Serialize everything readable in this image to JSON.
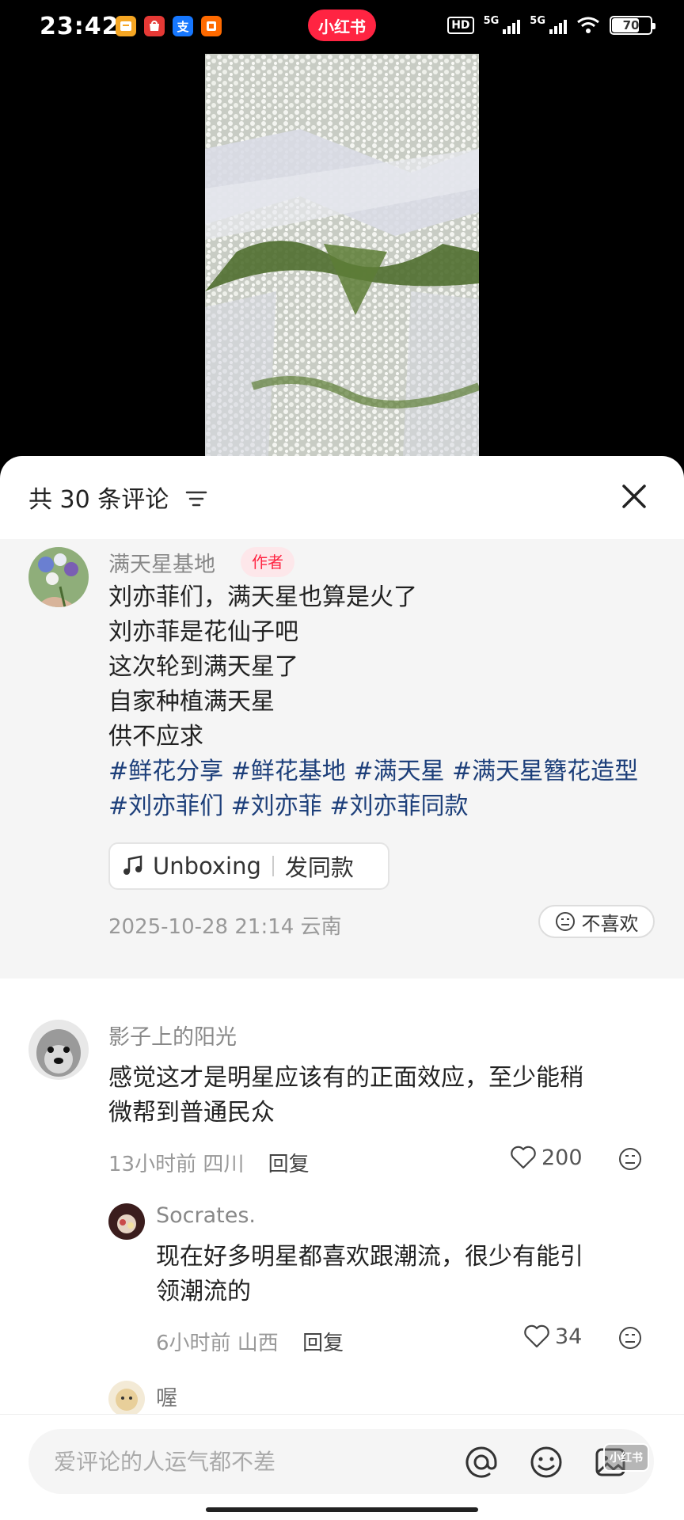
{
  "status_bar": {
    "time": "23:42",
    "app_icons": [
      {
        "icon": "app-notify-icon",
        "label": "",
        "color": "#f5a623"
      },
      {
        "icon": "app-shop-icon",
        "label": "",
        "color": "#e53935"
      },
      {
        "icon": "alipay-icon",
        "label": "支",
        "color": "#1677ff"
      },
      {
        "icon": "app-listen-icon",
        "label": "",
        "color": "#ff6a00"
      }
    ],
    "brand": "小红书",
    "hd_label": "HD",
    "net1": "5G",
    "net2": "5G",
    "battery": "70"
  },
  "sheet": {
    "count_label": "共 30 条评论"
  },
  "author_comment": {
    "name": "满天星基地",
    "badge": "作者",
    "lines": [
      "刘亦菲们，满天星也算是火了",
      "刘亦菲是花仙子吧",
      "这次轮到满天星了",
      "自家种植满天星",
      "供不应求"
    ],
    "tags": "#鲜花分享 #鲜花基地 #满天星 #满天星簪花造型 #刘亦菲们 #刘亦菲 #刘亦菲同款",
    "music_title": "Unboxing",
    "music_action": "发同款",
    "meta": "2025-10-28 21:14 云南",
    "dislike_label": "不喜欢"
  },
  "comments": [
    {
      "name": "影子上的阳光",
      "lines": [
        "感觉这才是明星应该有的正面效应，至少能稍",
        "微帮到普通民众"
      ],
      "meta": "13小时前 四川",
      "reply_label": "回复",
      "likes": "200"
    }
  ],
  "replies": [
    {
      "name": "Socrates.",
      "lines": [
        "现在好多明星都喜欢跟潮流，很少有能引",
        "领潮流的"
      ],
      "meta": "6小时前 山西",
      "reply_label": "回复",
      "likes": "34"
    },
    {
      "name": "喔"
    }
  ],
  "input": {
    "placeholder": "爱评论的人运气都不差",
    "watermark": "小红书"
  },
  "colors": {
    "brand": "#ff2442",
    "hashtag": "#1d3f7a",
    "meta": "#999999"
  }
}
